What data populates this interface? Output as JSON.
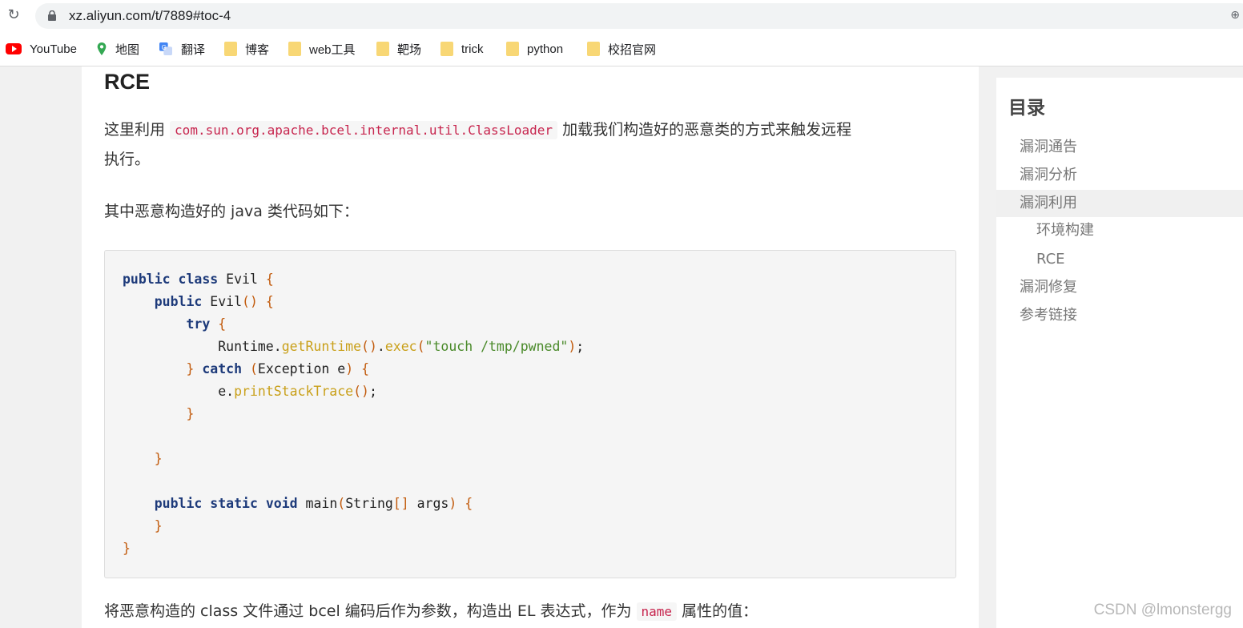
{
  "browser": {
    "url": "xz.aliyun.com/t/7889#toc-4",
    "bookmarks": [
      {
        "label": "YouTube",
        "icon": "youtube-icon"
      },
      {
        "label": "地图",
        "icon": "maps-pin-icon"
      },
      {
        "label": "翻译",
        "icon": "translate-icon"
      },
      {
        "label": "博客",
        "icon": "folder-icon"
      },
      {
        "label": "web工具",
        "icon": "folder-icon"
      },
      {
        "label": "靶场",
        "icon": "folder-icon"
      },
      {
        "label": "trick",
        "icon": "folder-icon"
      },
      {
        "label": "python",
        "icon": "folder-icon"
      },
      {
        "label": "校招官网",
        "icon": "folder-icon"
      }
    ]
  },
  "article": {
    "heading": "RCE",
    "p1_before": "这里利用 ",
    "p1_code": "com.sun.org.apache.bcel.internal.util.ClassLoader",
    "p1_after": " 加载我们构造好的恶意类的方式来触发远程",
    "p1_line2": "执行。",
    "p2": "其中恶意构造好的 java 类代码如下：",
    "p3_before": "将恶意构造的 class 文件通过 bcel 编码后作为参数，构造出 EL 表达式，作为 ",
    "p3_code": "name",
    "p3_after": " 属性的值："
  },
  "toc": {
    "title": "目录",
    "items": [
      {
        "label": "漏洞通告",
        "level": 1,
        "active": false
      },
      {
        "label": "漏洞分析",
        "level": 1,
        "active": false
      },
      {
        "label": "漏洞利用",
        "level": 1,
        "active": true
      },
      {
        "label": "环境构建",
        "level": 2,
        "active": false
      },
      {
        "label": "RCE",
        "level": 2,
        "active": false
      },
      {
        "label": "漏洞修复",
        "level": 1,
        "active": false
      },
      {
        "label": "参考链接",
        "level": 1,
        "active": false
      }
    ]
  },
  "watermark": "CSDN @lmonstergg",
  "colors": {
    "keyword": "#1d3a7a",
    "bracket": "#c25b0d",
    "method": "#c9a01a",
    "string": "#4a8a2a",
    "inline_code": "#c7254e"
  }
}
